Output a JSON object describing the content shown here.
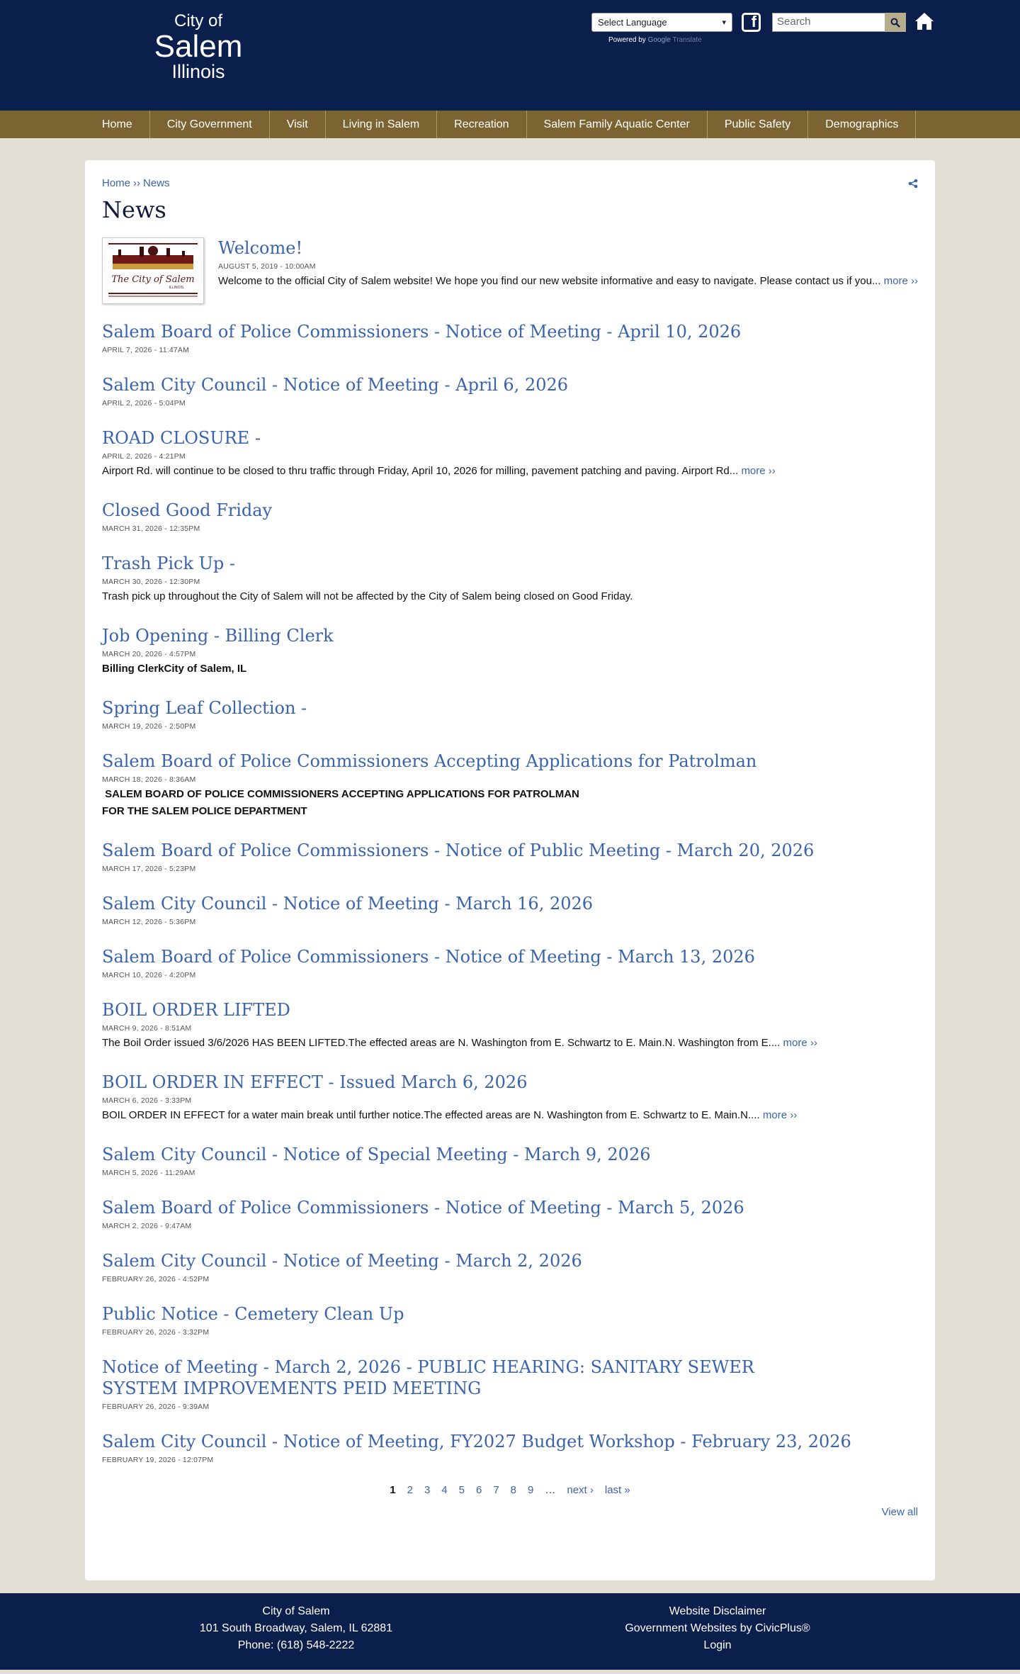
{
  "header": {
    "logo": {
      "line1": "City of",
      "line2": "Salem",
      "line3": "Illinois"
    },
    "language_select": "Select Language",
    "powered_by": "Powered by",
    "google": "Google",
    "translate": "Translate",
    "search_placeholder": "Search"
  },
  "nav": {
    "items": [
      "Home",
      "City Government",
      "Visit",
      "Living in Salem",
      "Recreation",
      "Salem Family Aquatic Center",
      "Public Safety",
      "Demographics"
    ]
  },
  "breadcrumb": {
    "home": "Home",
    "sep": "››",
    "current": "News"
  },
  "page_title": "News",
  "featured": {
    "title": "Welcome!",
    "date": "August 5, 2019 - 10:00am",
    "desc": "Welcome to the official City of Salem website! We hope you find our new website informative and easy to navigate. Please contact us if you...",
    "more": "more ››",
    "thumb_text": "The City of Salem",
    "thumb_sub": "ILLINOIS"
  },
  "news": [
    {
      "title": "Salem Board of Police Commissioners - Notice of Meeting - April 10, 2026",
      "date": "April 7, 2026 - 11:47am"
    },
    {
      "title": "Salem City Council - Notice of Meeting - April 6, 2026",
      "date": "April 2, 2026 - 5:04pm"
    },
    {
      "title": "ROAD CLOSURE -",
      "date": "April 2, 2026 - 4:21pm",
      "desc": "Airport Rd. will continue to be closed to thru traffic through Friday, April 10, 2026 for milling, pavement patching and paving. Airport Rd...",
      "more": "more ››"
    },
    {
      "title": "Closed Good Friday",
      "date": "March 31, 2026 - 12:35pm"
    },
    {
      "title": "Trash Pick Up -",
      "date": "March 30, 2026 - 12:30pm",
      "desc": "Trash pick up throughout the City of Salem will not be affected by the City of Salem being closed on Good Friday."
    },
    {
      "title": "Job Opening - Billing Clerk",
      "date": "March 20, 2026 - 4:57pm",
      "desc_bold": "Billing ClerkCity of Salem, IL"
    },
    {
      "title": "Spring Leaf Collection -",
      "date": "March 19, 2026 - 2:50pm"
    },
    {
      "title": "Salem Board of Police Commissioners Accepting Applications for Patrolman",
      "date": "March 18, 2026 - 8:36am",
      "desc_bold_l1": " SALEM BOARD OF POLICE COMMISSIONERS ACCEPTING APPLICATIONS FOR PATROLMAN",
      "desc_bold_l2": "FOR THE SALEM POLICE DEPARTMENT"
    },
    {
      "title": "Salem Board of Police Commissioners - Notice of Public Meeting - March 20, 2026",
      "date": "March 17, 2026 - 5:23pm"
    },
    {
      "title": "Salem City Council - Notice of Meeting - March 16, 2026",
      "date": "March 12, 2026 - 5:36pm"
    },
    {
      "title": "Salem Board of Police Commissioners - Notice of Meeting - March 13, 2026",
      "date": "March 10, 2026 - 4:20pm"
    },
    {
      "title": "BOIL ORDER LIFTED",
      "date": "March 9, 2026 - 8:51am",
      "desc": "The Boil Order issued 3/6/2026 HAS BEEN LIFTED.The effected areas are N. Washington from E. Schwartz to E. Main.N. Washington from E....",
      "more": "more ››"
    },
    {
      "title": "BOIL ORDER IN EFFECT - Issued March 6, 2026",
      "date": "March 6, 2026 - 3:33pm",
      "desc": "BOIL ORDER IN EFFECT for a water main break until further notice.The effected areas are N. Washington from E. Schwartz to E. Main.N....",
      "more": "more ››"
    },
    {
      "title": "Salem City Council - Notice of Special Meeting - March 9, 2026",
      "date": "March 5, 2026 - 11:29am"
    },
    {
      "title": "Salem Board of Police Commissioners - Notice of Meeting - March 5, 2026",
      "date": "March 2, 2026 - 9:47am"
    },
    {
      "title": "Salem City Council - Notice of Meeting - March 2, 2026",
      "date": "February 26, 2026 - 4:52pm"
    },
    {
      "title": "Public Notice - Cemetery Clean Up",
      "date": "February 26, 2026 - 3:32pm"
    },
    {
      "title": "Notice of Meeting - March 2, 2026 - PUBLIC HEARING: SANITARY SEWER SYSTEM IMPROVEMENTS PEID MEETING",
      "date": "February 26, 2026 - 9:39am"
    },
    {
      "title": "Salem City Council - Notice of Meeting, FY2027 Budget Workshop - February 23, 2026",
      "date": "February 19, 2026 - 12:07pm"
    }
  ],
  "pager": {
    "pages": [
      "1",
      "2",
      "3",
      "4",
      "5",
      "6",
      "7",
      "8",
      "9"
    ],
    "ellipsis": "…",
    "next": "next ›",
    "last": "last »"
  },
  "view_all": "View all",
  "footer": {
    "left": [
      "City of Salem",
      "101 South Broadway, Salem, IL 62881",
      "Phone: (618) 548-2222"
    ],
    "right": [
      "Website Disclaimer",
      "Government Websites by CivicPlus®",
      "Login"
    ]
  },
  "colors": {
    "header_bg": "#0b1f4d",
    "nav_bg": "#7b6431",
    "link": "#3a63ad",
    "page_bg": "#e1dfd3"
  }
}
